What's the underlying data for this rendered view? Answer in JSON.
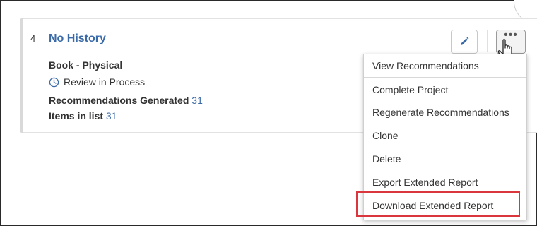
{
  "card": {
    "index": "4",
    "title": "No History",
    "type": "Book - Physical",
    "status": "Review in Process",
    "recs_label": "Recommendations Generated",
    "recs_count": "31",
    "items_label": "Items in list",
    "items_count": "31"
  },
  "menu": {
    "items": [
      "View Recommendations",
      "Complete Project",
      "Regenerate Recommendations",
      "Clone",
      "Delete",
      "Export Extended Report",
      "Download Extended Report"
    ]
  },
  "icons": {
    "edit": "pencil-icon",
    "more": "more-options-icon",
    "status": "clock-icon",
    "cursor": "hand-pointer-icon"
  },
  "colors": {
    "accent_blue": "#3a6aa8",
    "highlight_red": "#d9363e"
  }
}
